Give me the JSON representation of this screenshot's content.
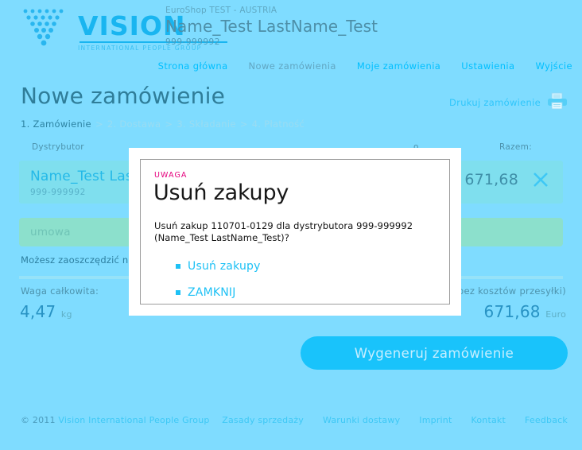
{
  "brand": {
    "word": "VISION",
    "tagline": "INTERNATIONAL PEOPLE GROUP",
    "logo_icon": "vision-triangle-dots-logo"
  },
  "header": {
    "shop": "EuroShop TEST - AUSTRIA",
    "user_name": "Name_Test LastName_Test",
    "user_id": "999-999992"
  },
  "nav": {
    "items": [
      {
        "label": "Strona główna",
        "current": false
      },
      {
        "label": "Nowe zamówienia",
        "current": true
      },
      {
        "label": "Moje zamówienia",
        "current": false
      },
      {
        "label": "Ustawienia",
        "current": false
      },
      {
        "label": "Wyjście",
        "current": false
      }
    ]
  },
  "title": {
    "page_title": "Nowe zamówienie",
    "print_label": "Drukuj zamówienie",
    "print_icon": "printer-icon"
  },
  "breadcrumb": {
    "steps": [
      {
        "label": "1. Zamówienie",
        "active": true
      },
      {
        "label": "2. Dostawa",
        "active": false
      },
      {
        "label": "3. Składanie",
        "active": false
      },
      {
        "label": "4. Płatność",
        "active": false
      }
    ],
    "separator": ">"
  },
  "columns": {
    "distributor": "Dystrybutor",
    "middle": "o",
    "total": "Razem:"
  },
  "distributor_row": {
    "name": "Name_Test LastName_Test",
    "id": "999-999992",
    "total": "671,68",
    "remove_icon": "close-x-icon"
  },
  "contract_row": {
    "label": "umowa"
  },
  "save_note": "Możesz zaoszczędzić na",
  "totals": {
    "weight_label": "Waga całkowita:",
    "weight_value": "4,47",
    "weight_unit": "kg",
    "sum_label": "(bez kosztów przesyłki)",
    "sum_value": "671,68",
    "sum_unit": "Euro"
  },
  "cta": {
    "label": "Wygeneruj zamówienie"
  },
  "footer": {
    "copyright_prefix": "© 2011",
    "copyright_brand": "Vision International People Group",
    "links": [
      "Zasady sprzedaży",
      "Warunki dostawy",
      "Imprint",
      "Kontakt",
      "Feedback"
    ]
  },
  "modal": {
    "kicker": "UWAGA",
    "title": "Usuń zakupy",
    "body": "Usuń zakup 110701-0129 dla dystrybutora 999-999992 (Name_Test LastName_Test)?",
    "confirm_label": "Usuń zakupy",
    "cancel_label": "ZAMKNIJ"
  },
  "colors": {
    "page_background": "#7fdcff",
    "accent_cyan": "#19c3fb",
    "row_background": "#7fdfee",
    "contract_row_background": "#8ce0cc",
    "alert_magenta": "#e5007d",
    "heading_blue": "#2f7d99"
  }
}
